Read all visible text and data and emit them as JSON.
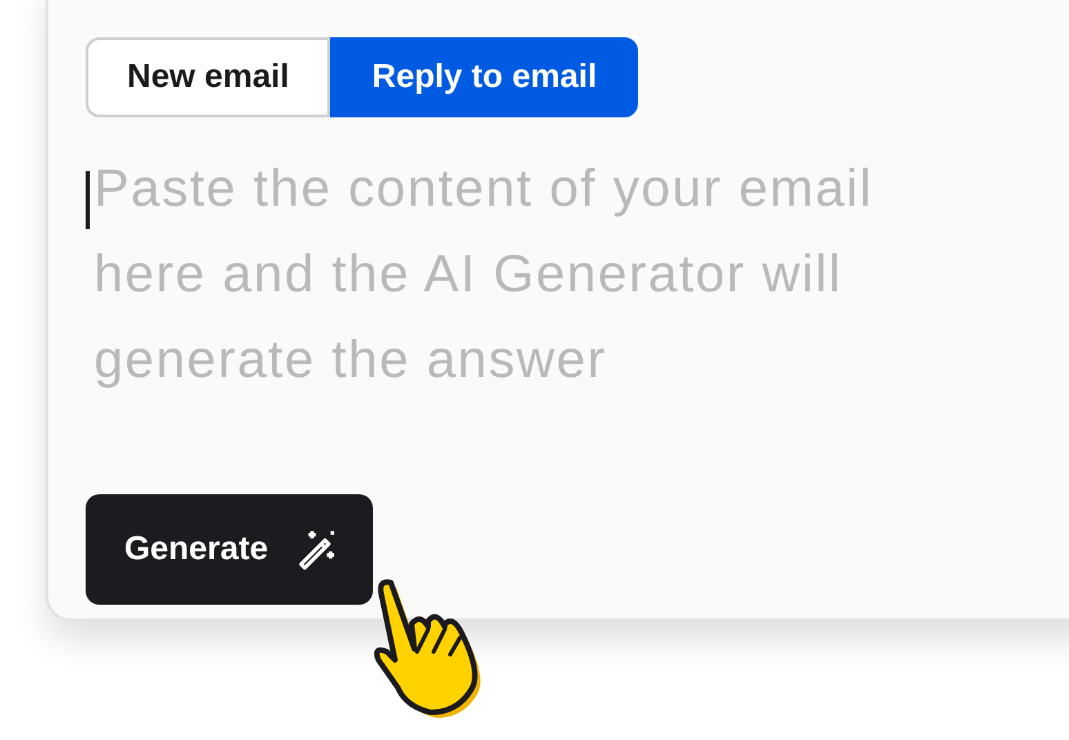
{
  "tabs": [
    {
      "label": "New email",
      "selected": false
    },
    {
      "label": "Reply to email",
      "selected": true
    }
  ],
  "message": {
    "placeholder": "Paste the content of your email here and the AI Generator will generate the answer"
  },
  "generate_button": {
    "label": "Generate"
  }
}
